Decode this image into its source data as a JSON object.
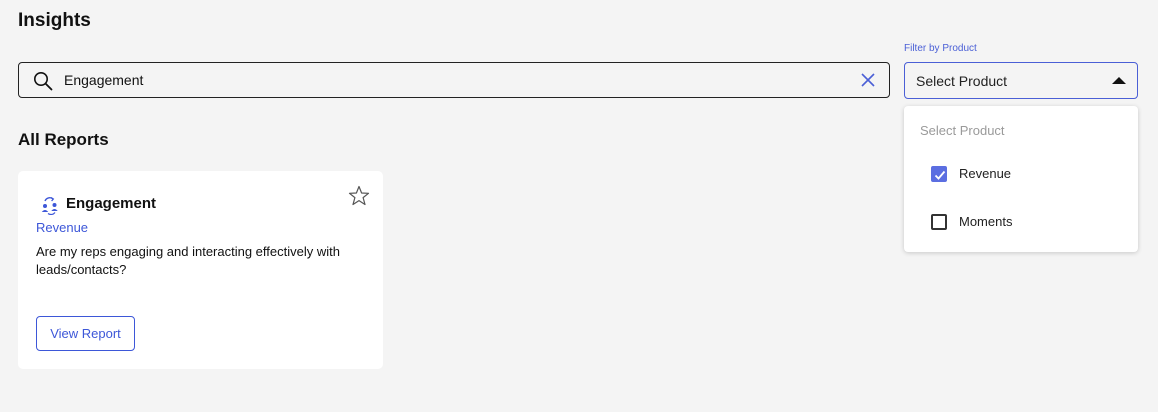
{
  "page": {
    "title": "Insights"
  },
  "search": {
    "value": "Engagement"
  },
  "filter": {
    "label": "Filter by Product",
    "selected_text": "Select Product",
    "dropdown": {
      "placeholder": "Select Product",
      "options": [
        {
          "label": "Revenue",
          "checked": true
        },
        {
          "label": "Moments",
          "checked": false
        }
      ]
    }
  },
  "reports": {
    "section_title": "All Reports",
    "cards": [
      {
        "title": "Engagement",
        "product": "Revenue",
        "description": "Are my reps engaging and interacting effectively with leads/contacts?",
        "button_label": "View Report",
        "icon": "engagement-icon",
        "starred": false
      }
    ]
  },
  "colors": {
    "accent": "#4a5fd6",
    "link": "#3d57d8",
    "checkbox_checked": "#5b6ee1",
    "background": "#f4f4f4"
  }
}
